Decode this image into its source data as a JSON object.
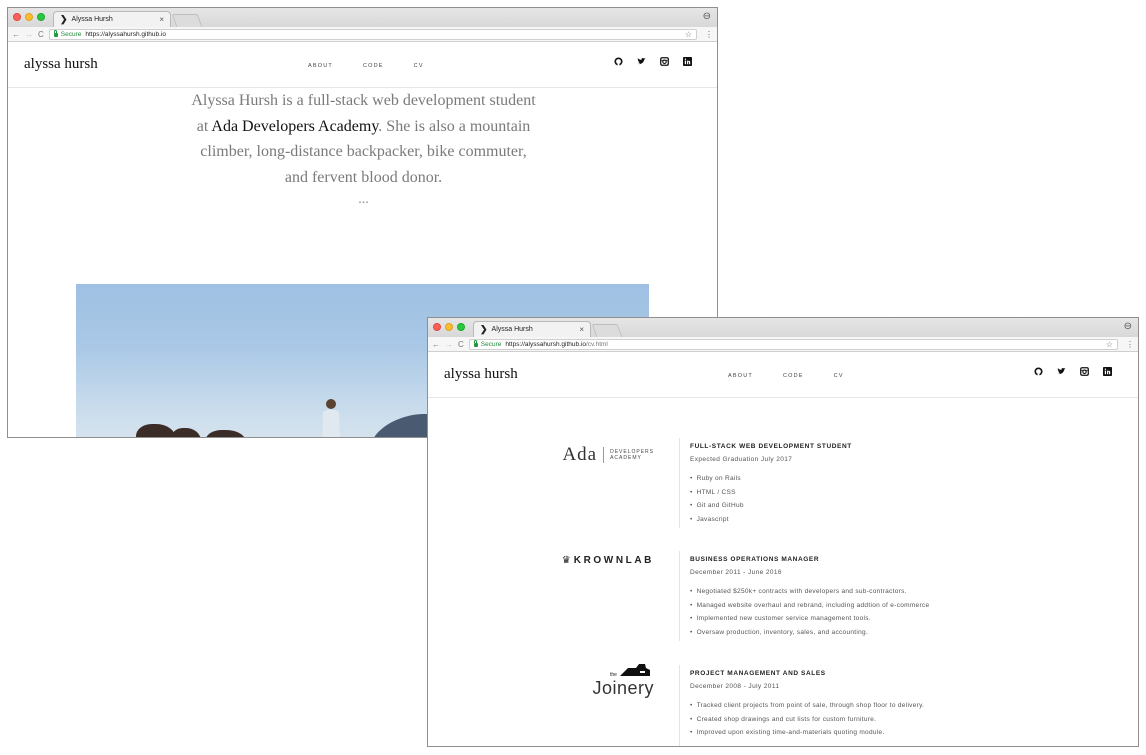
{
  "back_window": {
    "tab_title": "Alyssa Hursh",
    "secure_label": "Secure",
    "url": "https://alyssahursh.github.io",
    "url_path": "",
    "site": {
      "brand": "alyssa hursh",
      "nav": [
        "ABOUT",
        "CODE",
        "CV"
      ]
    },
    "hero": {
      "line1": "Alyssa Hursh is a full-stack web development student",
      "line2_pre": "at ",
      "line2_link": "Ada Developers Academy",
      "line2_post": ". She is also a mountain",
      "line3": "climber, long-distance backpacker, bike commuter,",
      "line4": "and fervent blood donor.",
      "ellipsis": "..."
    }
  },
  "front_window": {
    "tab_title": "Alyssa Hursh",
    "secure_label": "Secure",
    "url": "https://alyssahursh.github.io",
    "url_path": "/cv.html",
    "site": {
      "brand": "alyssa hursh",
      "nav": [
        "ABOUT",
        "CODE",
        "CV"
      ]
    },
    "cv": [
      {
        "logo": {
          "word": "Ada",
          "sub1": "DEVELOPERS",
          "sub2": "ACADEMY"
        },
        "title": "FULL-STACK WEB DEVELOPMENT STUDENT",
        "dates": "Expected Graduation July 2017",
        "items": [
          "Ruby on Rails",
          "HTML / CSS",
          "Git and GitHub",
          "Javascript"
        ]
      },
      {
        "logo": {
          "word": "KROWNLAB"
        },
        "title": "BUSINESS OPERATIONS MANAGER",
        "dates": "December 2011 - June 2016",
        "items": [
          "Negotiated $250k+ contracts with developers and sub-contractors.",
          "Managed website overhaul and rebrand, including addtion of e-commerce",
          "Implemented new customer service management tools.",
          "Oversaw production, inventory, sales, and accounting."
        ]
      },
      {
        "logo": {
          "small": "the",
          "word": "Joinery"
        },
        "title": "PROJECT MANAGEMENT AND SALES",
        "dates": "December 2008 - July 2011",
        "items": [
          "Tracked client projects from point of sale, through shop floor to delivery.",
          "Created shop drawings and cut lists for custom furniture.",
          "Improved upon existing time-and-materials quoting module."
        ]
      }
    ]
  },
  "icons": {
    "social": [
      "github-icon",
      "twitter-icon",
      "instagram-icon",
      "linkedin-icon"
    ]
  },
  "colors": {
    "secure_green": "#1f8a3a",
    "hero_text": "#7a7a7a",
    "hero_link": "#111111"
  }
}
